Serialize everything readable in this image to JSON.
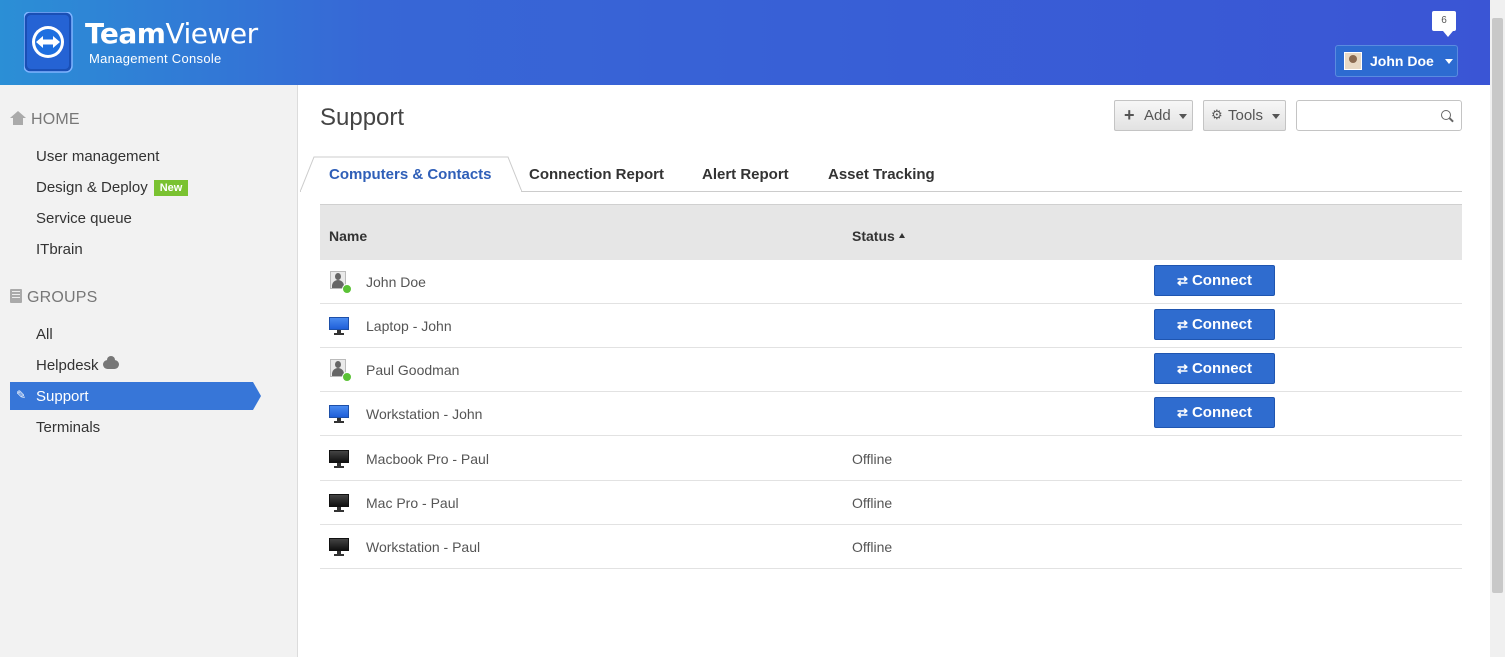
{
  "header": {
    "brand_bold": "Team",
    "brand_regular": "Viewer",
    "subtitle": "Management Console",
    "notification_count": "6",
    "user_name": "John Doe"
  },
  "sidebar": {
    "home_heading": "HOME",
    "home_items": [
      {
        "label": "User management"
      },
      {
        "label": "Design & Deploy",
        "badge": "New"
      },
      {
        "label": "Service queue"
      },
      {
        "label": "ITbrain"
      }
    ],
    "groups_heading": "GROUPS",
    "group_items": [
      {
        "label": "All"
      },
      {
        "label": "Helpdesk",
        "icon": "cloud-icon"
      },
      {
        "label": "Support",
        "active": true,
        "icon": "pencil-icon"
      },
      {
        "label": "Terminals"
      }
    ]
  },
  "main": {
    "title": "Support",
    "add_label": "Add",
    "tools_label": "Tools",
    "search": {
      "value": "",
      "placeholder": ""
    },
    "tabs": [
      {
        "label": "Computers & Contacts",
        "active": true
      },
      {
        "label": "Connection Report"
      },
      {
        "label": "Alert Report"
      },
      {
        "label": "Asset Tracking"
      }
    ],
    "table": {
      "columns": {
        "name": "Name",
        "status": "Status"
      },
      "connect_label": "Connect",
      "rows": [
        {
          "name": "John Doe",
          "status": "",
          "icon": "contact-online-icon",
          "connect": true
        },
        {
          "name": "Laptop - John",
          "status": "",
          "icon": "computer-online-icon",
          "connect": true
        },
        {
          "name": "Paul Goodman",
          "status": "",
          "icon": "contact-online-icon",
          "connect": true
        },
        {
          "name": "Workstation - John",
          "status": "",
          "icon": "computer-online-icon",
          "connect": true
        },
        {
          "name": "Macbook Pro - Paul",
          "status": "Offline",
          "icon": "computer-offline-icon",
          "connect": false
        },
        {
          "name": "Mac Pro - Paul",
          "status": "Offline",
          "icon": "computer-offline-icon",
          "connect": false
        },
        {
          "name": "Workstation - Paul",
          "status": "Offline",
          "icon": "computer-offline-icon",
          "connect": false
        }
      ]
    }
  },
  "colors": {
    "header_blue": "#3a55d5",
    "active_nav": "#3776d8",
    "connect_button": "#2f6ccf",
    "new_badge": "#7ac231",
    "online_dot": "#5bc236"
  }
}
